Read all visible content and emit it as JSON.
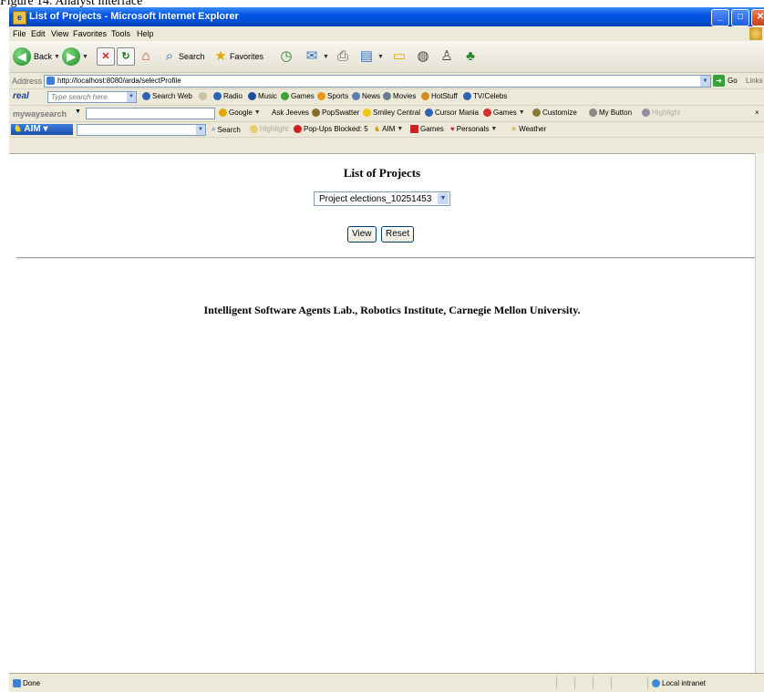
{
  "caption": "Figure 14. Analyst interface",
  "window": {
    "title": "List of Projects - Microsoft Internet Explorer"
  },
  "menu": [
    "File",
    "Edit",
    "View",
    "Favorites",
    "Tools",
    "Help"
  ],
  "toolbar": {
    "back": "Back",
    "search": "Search",
    "favorites": "Favorites"
  },
  "address": {
    "label": "Address",
    "url": "http://localhost:8080/arda/selectProfile",
    "go": "Go",
    "links": "Links"
  },
  "real_toolbar": {
    "brand": "real",
    "search_placeholder": "Type search here",
    "search_web": "Search Web",
    "items": [
      "Radio",
      "Music",
      "Games",
      "Sports",
      "News",
      "Movies",
      "HotStuff",
      "TV/Celebs"
    ]
  },
  "myway_toolbar": {
    "brand": "mywaysearch",
    "items": [
      "Google",
      "Ask Jeeves",
      "PopSwatter",
      "Smiley Central",
      "Cursor Mania",
      "Games",
      "Customize",
      "My Button",
      "Highlight"
    ]
  },
  "aim_toolbar": {
    "brand": "AIM",
    "items": [
      "Search",
      "Highlight",
      "Pop-Ups Blocked: 5",
      "AIM",
      "Games",
      "Personals",
      "Weather"
    ]
  },
  "page": {
    "title": "List of Projects",
    "project_select": "Project elections_10251453",
    "view_label": "View",
    "reset_label": "Reset",
    "footer": "Intelligent Software Agents Lab., Robotics Institute, Carnegie Mellon University."
  },
  "status": {
    "text": "Done",
    "zone": "Local intranet"
  }
}
